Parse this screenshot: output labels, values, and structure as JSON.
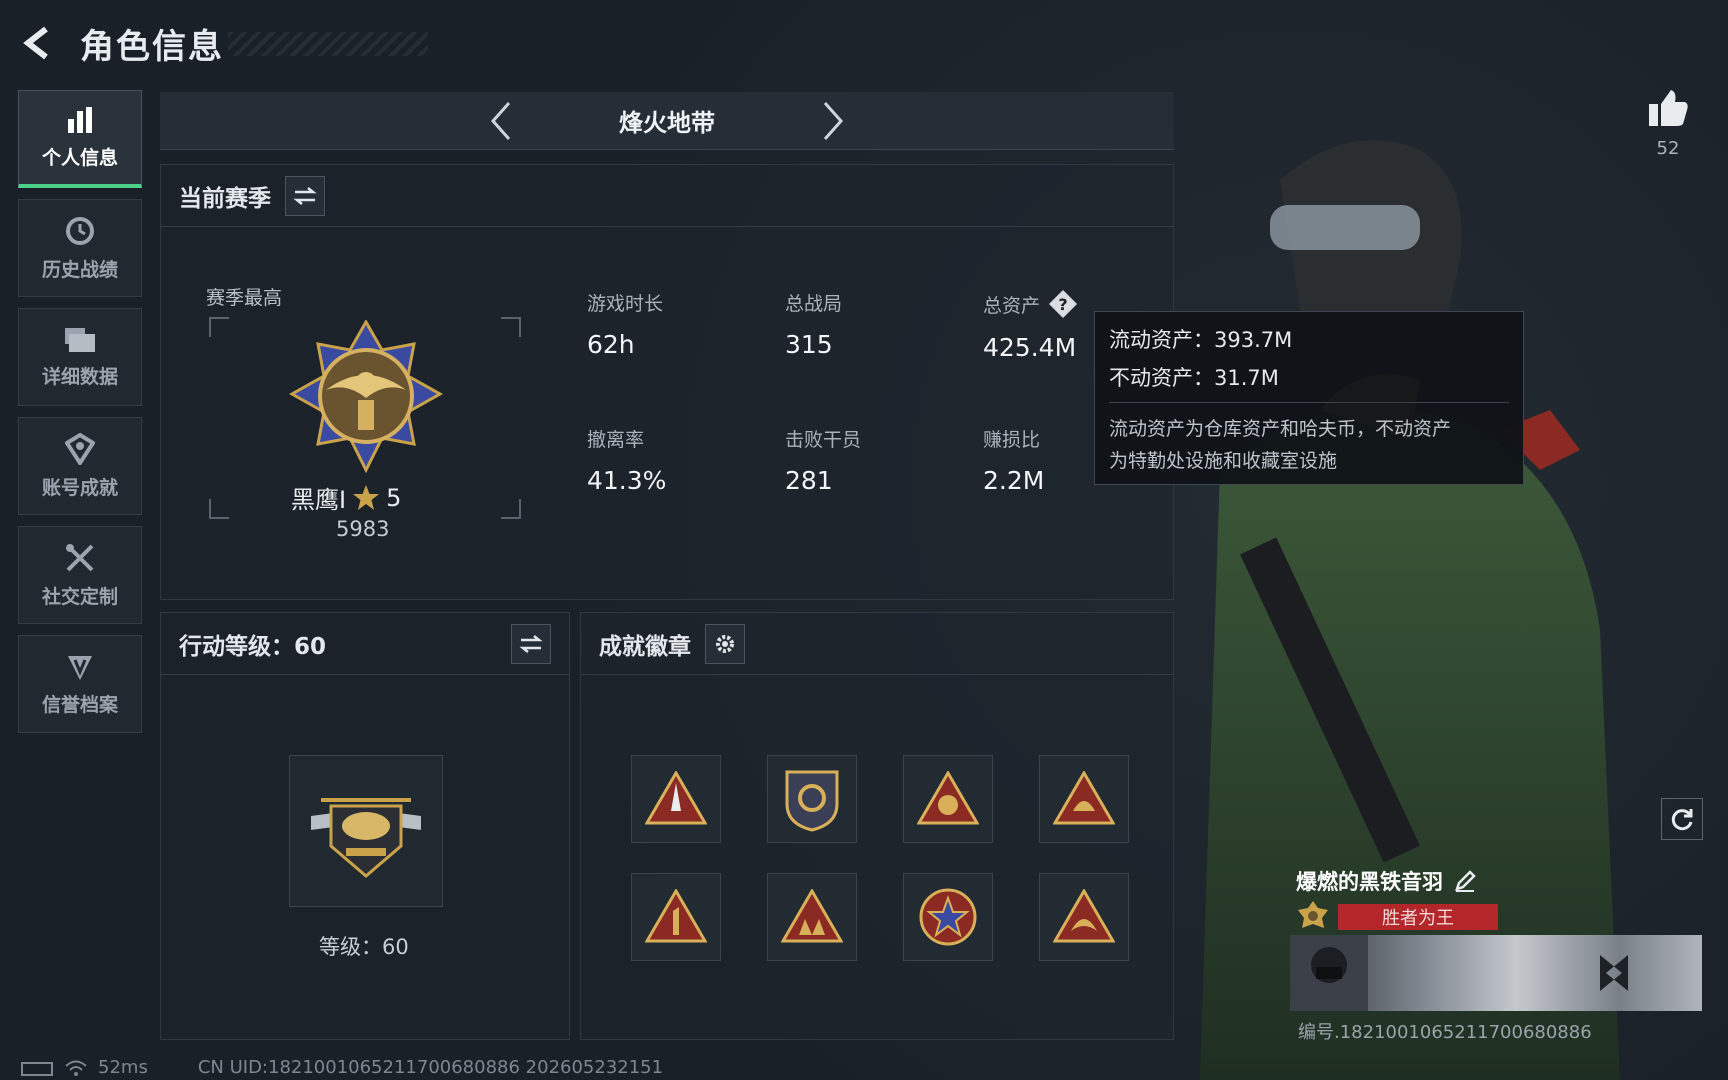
{
  "header": {
    "title": "角色信息"
  },
  "nav": {
    "items": [
      {
        "label": "个人信息",
        "icon": "bar-chart-icon",
        "active": true
      },
      {
        "label": "历史战绩",
        "icon": "history-icon"
      },
      {
        "label": "详细数据",
        "icon": "folder-icon"
      },
      {
        "label": "账号成就",
        "icon": "achievement-icon"
      },
      {
        "label": "社交定制",
        "icon": "tools-icon"
      },
      {
        "label": "信誉档案",
        "icon": "credit-icon"
      }
    ]
  },
  "mode": {
    "title": "烽火地带"
  },
  "season": {
    "title": "当前赛季",
    "best_label": "赛季最高",
    "rank_name": "黑鹰I",
    "rank_stars": "5",
    "rank_score": "5983",
    "stats": [
      {
        "label": "游戏时长",
        "value": "62h"
      },
      {
        "label": "总战局",
        "value": "315"
      },
      {
        "label": "总资产",
        "value": "425.4M",
        "help": true
      },
      {
        "label": "撤离率",
        "value": "41.3%"
      },
      {
        "label": "击败干员",
        "value": "281"
      },
      {
        "label": "赚损比",
        "value": "2.2M"
      }
    ]
  },
  "tooltip": {
    "liquid": "流动资产：393.7M",
    "fixed": "不动资产：31.7M",
    "desc1": "流动资产为仓库资产和哈夫币，不动资产",
    "desc2": "为特勤处设施和收藏室设施"
  },
  "action": {
    "title": "行动等级：60",
    "level_text": "等级：60"
  },
  "badges": {
    "title": "成就徽章"
  },
  "like": {
    "count": "52"
  },
  "player": {
    "name": "爆燃的黑铁音羽",
    "title_tag": "胜者为王",
    "card_id": "编号.1821001065211700680886"
  },
  "footer": {
    "ping": "52ms",
    "uid": "CN UID:1821001065211700680886 202605232151"
  },
  "colors": {
    "accent_green": "#4dd08a",
    "title_red": "#b3262a",
    "gold": "#c9a24a"
  }
}
